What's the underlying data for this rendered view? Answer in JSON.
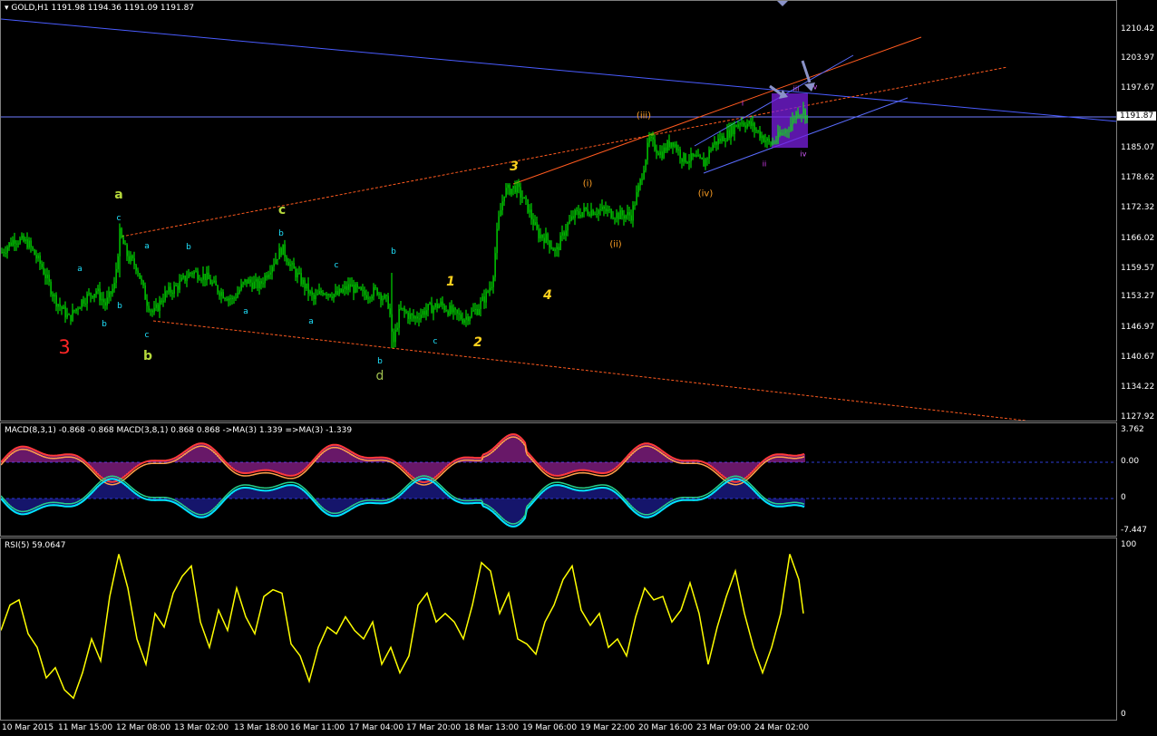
{
  "main": {
    "title": "GOLD,H1  1191.98 1194.36 1191.09 1191.87",
    "current_price": "1191.87",
    "axis_labels": [
      "1210.42",
      "1203.97",
      "1197.67",
      "1191.87",
      "1185.07",
      "1178.62",
      "1172.32",
      "1166.02",
      "1159.57",
      "1153.27",
      "1146.97",
      "1140.67",
      "1134.22",
      "1127.92"
    ],
    "wave_labels": [
      "3",
      "a",
      "b",
      "c",
      "d",
      "1",
      "2",
      "3",
      "4",
      "(i)",
      "(ii)",
      "(iii)",
      "(iv)",
      "i",
      "ii",
      "iii",
      "iv",
      "v",
      "a",
      "b",
      "c",
      "a",
      "b",
      "c",
      "b",
      "a",
      "b",
      "c",
      "a",
      "b",
      "c",
      "b"
    ]
  },
  "macd": {
    "title": "MACD(8,3,1) -0.868 -0.868  MACD(3,8,1) 0.868 0.868  ->MA(3) 1.339  =>MA(3) -1.339",
    "axis_labels": [
      "3.762",
      "0.00",
      "0",
      "-7.447"
    ]
  },
  "rsi": {
    "title": "RSI(5) 59.0647",
    "axis_labels": [
      "100",
      "0"
    ]
  },
  "time_axis": [
    "10 Mar 2015",
    "11 Mar 15:00",
    "12 Mar 08:00",
    "13 Mar 02:00",
    "13 Mar 18:00",
    "16 Mar 11:00",
    "17 Mar 04:00",
    "17 Mar 20:00",
    "18 Mar 13:00",
    "19 Mar 06:00",
    "19 Mar 22:00",
    "20 Mar 16:00",
    "23 Mar 09:00",
    "24 Mar 02:00"
  ],
  "colors": {
    "candles": "#00ff00",
    "trend_blue": "#4a5cff",
    "trend_orange": "#ff5a1f",
    "purple_box": "#7a1fe0",
    "rsi_line": "#ffff00",
    "macd_red": "#ff3a3a",
    "macd_orange": "#ffa04a",
    "macd_cyan": "#00e5ff",
    "macd_green": "#28d28a",
    "hist_magenta": "#d12fd1",
    "hist_blue": "#2a2ad6"
  },
  "chart_data": [
    {
      "type": "candlestick",
      "title": "GOLD,H1",
      "ohlc_last": [
        1191.98,
        1194.36,
        1191.09,
        1191.87
      ],
      "close_path": [
        [
          0,
          1163
        ],
        [
          15,
          1166
        ],
        [
          30,
          1165
        ],
        [
          45,
          1160
        ],
        [
          60,
          1153
        ],
        [
          75,
          1149
        ],
        [
          90,
          1153
        ],
        [
          105,
          1155
        ],
        [
          115,
          1152
        ],
        [
          125,
          1156
        ],
        [
          131,
          1167
        ],
        [
          140,
          1162
        ],
        [
          150,
          1160
        ],
        [
          160,
          1153
        ],
        [
          168,
          1150
        ],
        [
          180,
          1154
        ],
        [
          195,
          1156
        ],
        [
          210,
          1159
        ],
        [
          225,
          1158
        ],
        [
          240,
          1155
        ],
        [
          255,
          1153
        ],
        [
          270,
          1157
        ],
        [
          285,
          1156
        ],
        [
          300,
          1161
        ],
        [
          310,
          1164
        ],
        [
          320,
          1160
        ],
        [
          335,
          1156
        ],
        [
          345,
          1153
        ],
        [
          355,
          1155
        ],
        [
          370,
          1154
        ],
        [
          385,
          1156
        ],
        [
          400,
          1154
        ],
        [
          415,
          1155
        ],
        [
          428,
          1152
        ],
        [
          432,
          1143
        ],
        [
          440,
          1151
        ],
        [
          455,
          1149
        ],
        [
          470,
          1151
        ],
        [
          485,
          1152
        ],
        [
          500,
          1150
        ],
        [
          510,
          1149
        ],
        [
          525,
          1151
        ],
        [
          535,
          1154
        ],
        [
          542,
          1157
        ],
        [
          548,
          1169
        ],
        [
          555,
          1176
        ],
        [
          568,
          1177
        ],
        [
          580,
          1173
        ],
        [
          592,
          1167
        ],
        [
          602,
          1166
        ],
        [
          612,
          1163
        ],
        [
          622,
          1168
        ],
        [
          632,
          1171
        ],
        [
          645,
          1172
        ],
        [
          655,
          1172
        ],
        [
          665,
          1172
        ],
        [
          680,
          1171
        ],
        [
          695,
          1171
        ],
        [
          705,
          1178
        ],
        [
          715,
          1187
        ],
        [
          728,
          1184
        ],
        [
          740,
          1187
        ],
        [
          752,
          1183
        ],
        [
          765,
          1183
        ],
        [
          775,
          1182
        ],
        [
          785,
          1186
        ],
        [
          800,
          1188
        ],
        [
          815,
          1191
        ],
        [
          828,
          1190
        ],
        [
          838,
          1188
        ],
        [
          848,
          1186
        ],
        [
          860,
          1188
        ],
        [
          870,
          1190
        ],
        [
          878,
          1193
        ],
        [
          885,
          1193
        ],
        [
          889,
          1192
        ]
      ],
      "ylim": [
        1127.92,
        1213.0
      ]
    },
    {
      "type": "line",
      "title": "RSI(5) 59.0647",
      "ylim": [
        0,
        100
      ],
      "x": [
        0,
        10,
        20,
        30,
        40,
        50,
        60,
        70,
        80,
        90,
        100,
        110,
        120,
        130,
        140,
        150,
        160,
        170,
        180,
        190,
        200,
        210,
        220,
        230,
        240,
        250,
        260,
        270,
        280,
        290,
        300,
        310,
        320,
        330,
        340,
        350,
        360,
        370,
        380,
        390,
        400,
        410,
        420,
        430,
        440,
        450,
        460,
        470,
        480,
        490,
        500,
        510,
        520,
        530,
        540,
        550,
        560,
        570,
        580,
        590,
        600,
        610,
        620,
        630,
        640,
        650,
        660,
        670,
        680,
        690,
        700,
        710,
        720,
        730,
        740,
        750,
        760,
        770,
        780,
        790,
        800,
        810,
        820,
        830,
        840,
        850,
        860,
        870,
        880,
        885
      ],
      "values": [
        50,
        65,
        68,
        48,
        40,
        22,
        28,
        15,
        10,
        25,
        45,
        32,
        70,
        95,
        75,
        45,
        30,
        60,
        52,
        72,
        82,
        88,
        55,
        40,
        62,
        50,
        75,
        58,
        48,
        70,
        74,
        72,
        42,
        35,
        20,
        40,
        52,
        48,
        58,
        50,
        45,
        55,
        30,
        40,
        25,
        35,
        65,
        72,
        55,
        60,
        55,
        45,
        65,
        90,
        85,
        60,
        72,
        45,
        42,
        36,
        55,
        65,
        80,
        88,
        62,
        53,
        60,
        40,
        45,
        35,
        58,
        75,
        68,
        70,
        55,
        62,
        78,
        60,
        30,
        52,
        70,
        85,
        60,
        40,
        25,
        40,
        60,
        95,
        80,
        60
      ],
      "series": [
        {
          "name": "RSI(5)",
          "last": 59.0647
        }
      ]
    },
    {
      "type": "line",
      "title": "MACD(8,3,1)",
      "ylim": [
        -7.447,
        3.762
      ],
      "series": [
        {
          "name": "MACD(8,3,1)",
          "last": -0.868
        },
        {
          "name": "MACD(3,8,1)",
          "last": 0.868
        },
        {
          "name": "->MA(3)",
          "last": 1.339
        },
        {
          "name": "=>MA(3)",
          "last": -1.339
        }
      ]
    }
  ]
}
